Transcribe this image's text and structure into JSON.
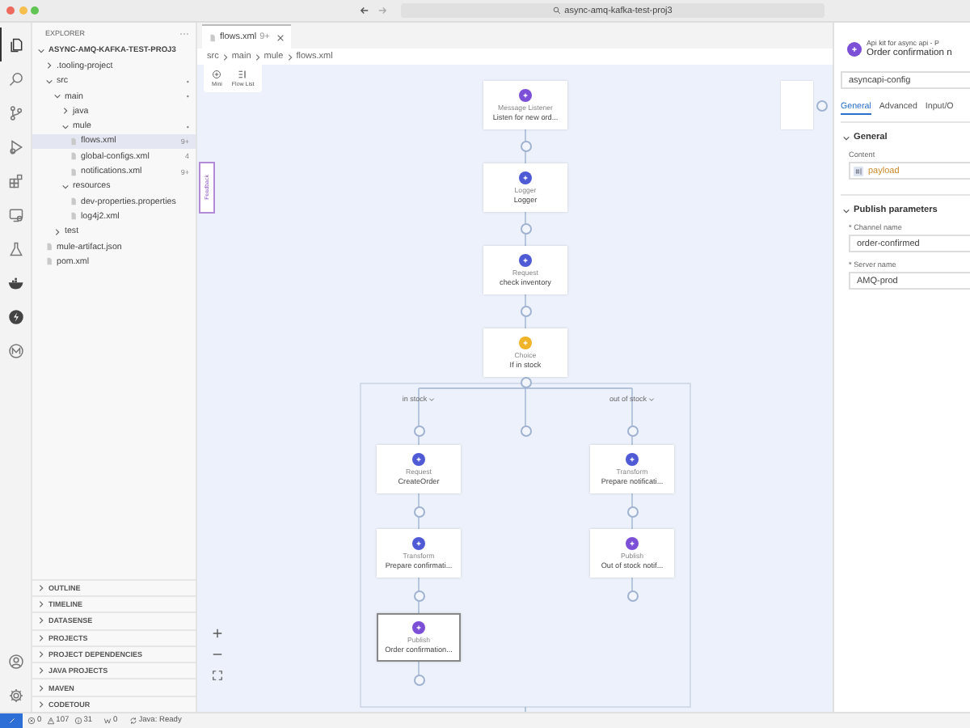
{
  "window": {
    "title": "async-amq-kafka-test-proj3"
  },
  "activity_bar": {
    "items": [
      {
        "kind": "files",
        "selected": true
      },
      {
        "kind": "search",
        "selected": false
      },
      {
        "kind": "source-control",
        "selected": false
      },
      {
        "kind": "run",
        "selected": false
      },
      {
        "kind": "extensions",
        "selected": false
      },
      {
        "kind": "remote",
        "selected": false
      },
      {
        "kind": "testing",
        "selected": false
      },
      {
        "kind": "docker",
        "selected": false
      },
      {
        "kind": "lightning",
        "selected": false
      },
      {
        "kind": "mule",
        "selected": false
      }
    ],
    "bottom": [
      {
        "kind": "account"
      },
      {
        "kind": "settings"
      }
    ]
  },
  "explorer": {
    "title": "EXPLORER",
    "root": {
      "label": "ASYNC-AMQ-KAFKA-TEST-PROJ3",
      "kind": "folder",
      "expanded": true,
      "children": [
        {
          "label": ".tooling-project",
          "kind": "folder",
          "expanded": false
        },
        {
          "label": "src",
          "kind": "folder",
          "expanded": true,
          "badge": "•",
          "children": [
            {
              "label": "main",
              "kind": "folder",
              "expanded": true,
              "badge": "•",
              "children": [
                {
                  "label": "java",
                  "kind": "folder",
                  "expanded": false
                },
                {
                  "label": "mule",
                  "kind": "folder",
                  "expanded": true,
                  "badge": "•",
                  "children": [
                    {
                      "label": "flows.xml",
                      "kind": "file",
                      "selected": true,
                      "badge": "9+"
                    },
                    {
                      "label": "global-configs.xml",
                      "kind": "file",
                      "selected": false,
                      "badge": "4"
                    },
                    {
                      "label": "notifications.xml",
                      "kind": "file",
                      "selected": false,
                      "badge": "9+"
                    }
                  ]
                },
                {
                  "label": "resources",
                  "kind": "folder",
                  "expanded": true,
                  "children": [
                    {
                      "label": "dev-properties.properties",
                      "kind": "file",
                      "selected": false
                    },
                    {
                      "label": "log4j2.xml",
                      "kind": "file",
                      "selected": false
                    }
                  ]
                }
              ]
            },
            {
              "label": "test",
              "kind": "folder",
              "expanded": false
            }
          ]
        },
        {
          "label": "mule-artifact.json",
          "kind": "file",
          "selected": false
        },
        {
          "label": "pom.xml",
          "kind": "file",
          "selected": false
        }
      ]
    },
    "sections": [
      {
        "label": "OUTLINE",
        "expanded": false
      },
      {
        "label": "TIMELINE",
        "expanded": false
      },
      {
        "label": "DATASENSE",
        "expanded": false
      },
      {
        "label": "PROJECTS",
        "expanded": false
      },
      {
        "label": "PROJECT DEPENDENCIES",
        "expanded": false
      },
      {
        "label": "JAVA PROJECTS",
        "expanded": false
      },
      {
        "label": "MAVEN",
        "expanded": false
      },
      {
        "label": "CODETOUR",
        "expanded": false
      }
    ]
  },
  "editor": {
    "tab": {
      "label": "flows.xml",
      "badge": "9+",
      "selected": true
    },
    "breadcrumb": [
      "src",
      "main",
      "mule",
      "flows.xml"
    ],
    "canvas_tools": [
      {
        "kind": "map",
        "label": "Mini"
      },
      {
        "kind": "list",
        "label": "Flow List"
      }
    ],
    "feedback": "Feedback",
    "flow": {
      "main": [
        {
          "kind": "listener",
          "type": "Message Listener",
          "name": "Listen for new ord...",
          "selected": false
        },
        {
          "kind": "logger",
          "type": "Logger",
          "name": "Logger",
          "selected": false
        },
        {
          "kind": "request",
          "type": "Request",
          "name": "check inventory",
          "selected": false
        },
        {
          "kind": "choice",
          "type": "Choice",
          "name": "If in stock",
          "selected": false
        }
      ],
      "default_branch": true,
      "branches": [
        {
          "label": "in stock",
          "nodes": [
            {
              "kind": "request",
              "type": "Request",
              "name": "CreateOrder",
              "selected": false
            },
            {
              "kind": "transform",
              "type": "Transform",
              "name": "Prepare confirmati...",
              "selected": false
            },
            {
              "kind": "publish",
              "type": "Publish",
              "name": "Order confirmation...",
              "selected": true
            }
          ]
        },
        {
          "label": "out of stock",
          "nodes": [
            {
              "kind": "transform",
              "type": "Transform",
              "name": "Prepare notificati...",
              "selected": false
            },
            {
              "kind": "publish",
              "type": "Publish",
              "name": "Out of stock notif...",
              "selected": false
            }
          ]
        }
      ]
    }
  },
  "properties": {
    "title": "Api kit for async api - P",
    "subtitle": "Order confirmation n",
    "config": "asyncapi-config",
    "tabs": [
      {
        "label": "General",
        "selected": true
      },
      {
        "label": "Advanced",
        "selected": false
      },
      {
        "label": "Input/O",
        "selected": false
      }
    ],
    "sections": [
      {
        "title": "General",
        "expanded": true,
        "fields": [
          {
            "kind": "expression",
            "label": "Content",
            "value": "payload"
          }
        ]
      },
      {
        "title": "Publish parameters",
        "expanded": true,
        "fields": [
          {
            "kind": "text",
            "label": "* Channel name",
            "value": "order-confirmed"
          },
          {
            "kind": "text",
            "label": "* Server name",
            "value": "AMQ-prod"
          }
        ]
      }
    ]
  },
  "status_bar": {
    "items": [
      {
        "kind": "errors",
        "text": "0"
      },
      {
        "kind": "warnings",
        "text": "107"
      },
      {
        "kind": "info",
        "text": "31"
      },
      {
        "kind": "ports",
        "text": "0"
      },
      {
        "kind": "java",
        "text": "Java: Ready"
      }
    ]
  }
}
